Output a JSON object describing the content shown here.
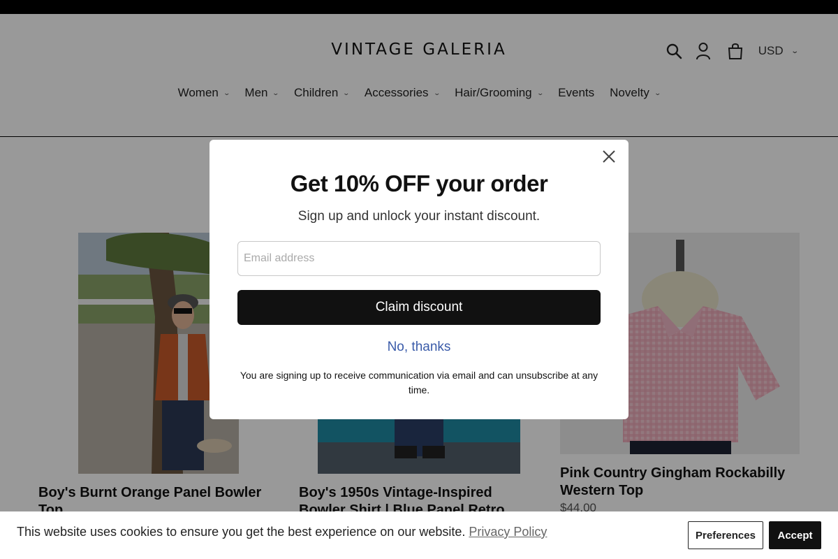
{
  "store": {
    "logo": "VINTAGE GALERIA",
    "currency": "USD"
  },
  "icons": {
    "search": "search-icon",
    "account": "account-icon",
    "cart": "cart-icon",
    "close": "close-icon"
  },
  "nav": {
    "items": [
      {
        "label": "Women",
        "dropdown": true
      },
      {
        "label": "Men",
        "dropdown": true
      },
      {
        "label": "Children",
        "dropdown": true
      },
      {
        "label": "Accessories",
        "dropdown": true
      },
      {
        "label": "Hair/Grooming",
        "dropdown": true
      },
      {
        "label": "Events",
        "dropdown": false
      },
      {
        "label": "Novelty",
        "dropdown": true
      }
    ]
  },
  "products": [
    {
      "title_line1": "Boy's Burnt Orange Panel Bowler",
      "title_line2": "Top",
      "price": ""
    },
    {
      "title_line1": "Boy's 1950s Vintage-Inspired",
      "title_line2": "Bowler Shirt | Blue Panel Retro",
      "price": ""
    },
    {
      "title_line1": "Pink Country Gingham Rockabilly",
      "title_line2": "Western Top",
      "price": "$44.00"
    }
  ],
  "popup": {
    "title": "Get 10% OFF your order",
    "subtitle": "Sign up and unlock your instant discount.",
    "email_placeholder": "Email address",
    "email_value": "",
    "claim_label": "Claim discount",
    "decline_label": "No, thanks",
    "legal": "You are signing up to receive communication via email and can unsubscribe at any time."
  },
  "cookie": {
    "text": "This website uses cookies to ensure you get the best experience on our website.",
    "link": "Privacy Policy",
    "preferences_label": "Preferences",
    "accept_label": "Accept"
  },
  "colors": {
    "overlay": "rgba(0,0,0,0.4)",
    "button_dark": "#111111",
    "link_blue": "#3a5ba9"
  }
}
